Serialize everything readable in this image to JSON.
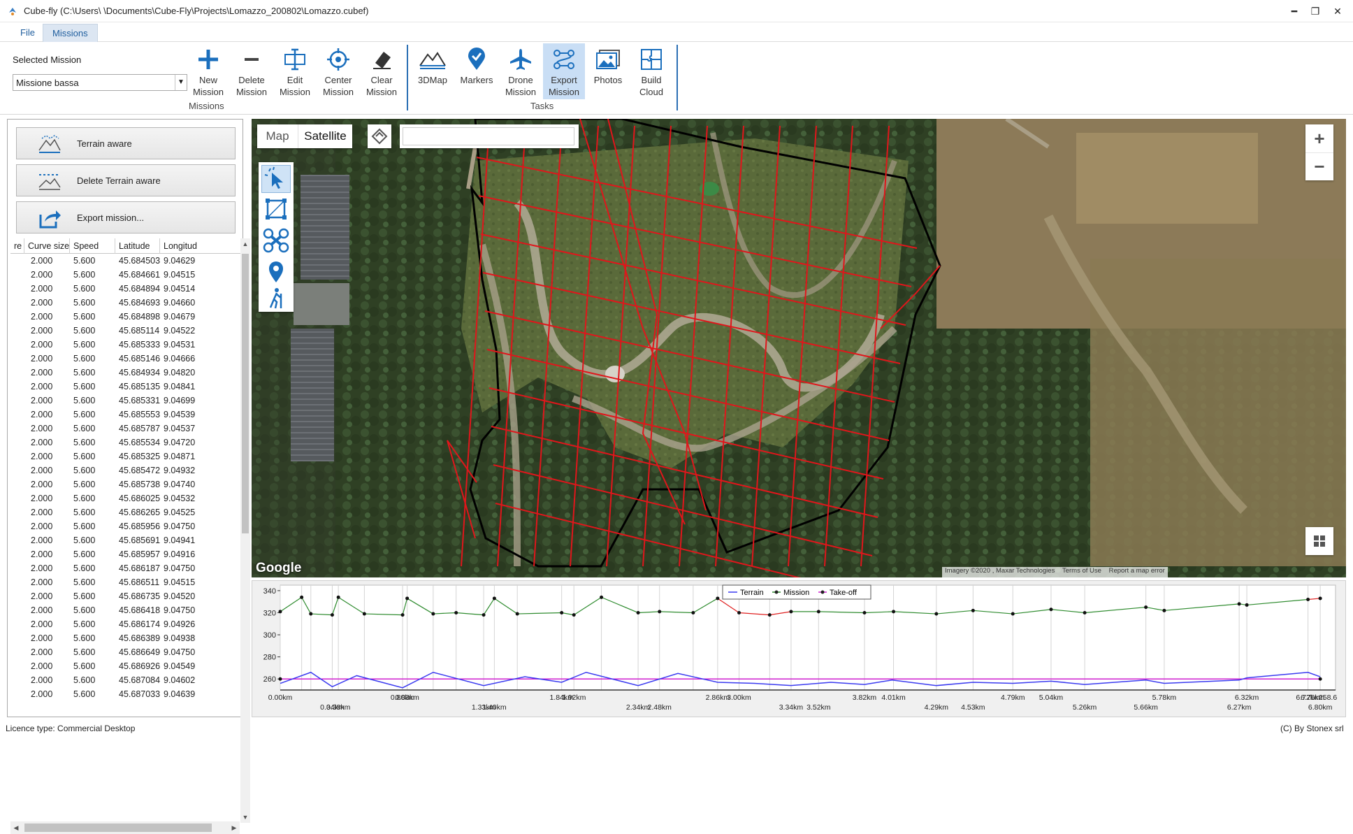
{
  "window": {
    "title": "Cube-fly (C:\\Users\\         \\Documents\\Cube-Fly\\Projects\\Lomazzo_200802\\Lomazzo.cubef)",
    "minimize": "━",
    "restore": "❐",
    "close": "✕"
  },
  "menu": {
    "tabs": [
      {
        "label": "File"
      },
      {
        "label": "Missions"
      }
    ]
  },
  "ribbon": {
    "selected_mission_label": "Selected Mission",
    "selected_mission_value": "Missione bassa",
    "groups": {
      "missions": "Missions",
      "tasks": "Tasks"
    },
    "buttons": {
      "new_mission": [
        "New",
        "Mission"
      ],
      "delete_mission": [
        "Delete",
        "Mission"
      ],
      "edit_mission": [
        "Edit",
        "Mission"
      ],
      "center_mission": [
        "Center",
        "Mission"
      ],
      "clear_mission": [
        "Clear",
        "Mission"
      ],
      "map3d": [
        "3DMap",
        ""
      ],
      "markers": [
        "Markers",
        ""
      ],
      "drone_mission": [
        "Drone",
        "Mission"
      ],
      "export_mission": [
        "Export",
        "Mission"
      ],
      "photos": [
        "Photos",
        ""
      ],
      "build_cloud": [
        "Build",
        "Cloud"
      ]
    },
    "accent": "#1b6fbd"
  },
  "left_panel": {
    "terrain_aware": "Terrain aware",
    "delete_terrain_aware": "Delete Terrain aware",
    "export_mission": "Export mission...",
    "table": {
      "columns": [
        "re",
        "Curve size",
        "Speed",
        "Latitude",
        "Longitud"
      ],
      "rows": [
        [
          "",
          "2.000",
          "5.600",
          "45.684503",
          "9.04629"
        ],
        [
          "",
          "2.000",
          "5.600",
          "45.684661",
          "9.04515"
        ],
        [
          "",
          "2.000",
          "5.600",
          "45.684894",
          "9.04514"
        ],
        [
          "",
          "2.000",
          "5.600",
          "45.684693",
          "9.04660"
        ],
        [
          "",
          "2.000",
          "5.600",
          "45.684898",
          "9.04679"
        ],
        [
          "",
          "2.000",
          "5.600",
          "45.685114",
          "9.04522"
        ],
        [
          "",
          "2.000",
          "5.600",
          "45.685333",
          "9.04531"
        ],
        [
          "",
          "2.000",
          "5.600",
          "45.685146",
          "9.04666"
        ],
        [
          "",
          "2.000",
          "5.600",
          "45.684934",
          "9.04820"
        ],
        [
          "",
          "2.000",
          "5.600",
          "45.685135",
          "9.04841"
        ],
        [
          "",
          "2.000",
          "5.600",
          "45.685331",
          "9.04699"
        ],
        [
          "",
          "2.000",
          "5.600",
          "45.685553",
          "9.04539"
        ],
        [
          "",
          "2.000",
          "5.600",
          "45.685787",
          "9.04537"
        ],
        [
          "",
          "2.000",
          "5.600",
          "45.685534",
          "9.04720"
        ],
        [
          "",
          "2.000",
          "5.600",
          "45.685325",
          "9.04871"
        ],
        [
          "",
          "2.000",
          "5.600",
          "45.685472",
          "9.04932"
        ],
        [
          "",
          "2.000",
          "5.600",
          "45.685738",
          "9.04740"
        ],
        [
          "",
          "2.000",
          "5.600",
          "45.686025",
          "9.04532"
        ],
        [
          "",
          "2.000",
          "5.600",
          "45.686265",
          "9.04525"
        ],
        [
          "",
          "2.000",
          "5.600",
          "45.685956",
          "9.04750"
        ],
        [
          "",
          "2.000",
          "5.600",
          "45.685691",
          "9.04941"
        ],
        [
          "",
          "2.000",
          "5.600",
          "45.685957",
          "9.04916"
        ],
        [
          "",
          "2.000",
          "5.600",
          "45.686187",
          "9.04750"
        ],
        [
          "",
          "2.000",
          "5.600",
          "45.686511",
          "9.04515"
        ],
        [
          "",
          "2.000",
          "5.600",
          "45.686735",
          "9.04520"
        ],
        [
          "",
          "2.000",
          "5.600",
          "45.686418",
          "9.04750"
        ],
        [
          "",
          "2.000",
          "5.600",
          "45.686174",
          "9.04926"
        ],
        [
          "",
          "2.000",
          "5.600",
          "45.686389",
          "9.04938"
        ],
        [
          "",
          "2.000",
          "5.600",
          "45.686649",
          "9.04750"
        ],
        [
          "",
          "2.000",
          "5.600",
          "45.686926",
          "9.04549"
        ],
        [
          "",
          "2.000",
          "5.600",
          "45.687084",
          "9.04602"
        ],
        [
          "",
          "2.000",
          "5.600",
          "45.687033",
          "9.04639"
        ]
      ]
    }
  },
  "map": {
    "tab_map": "Map",
    "tab_satellite": "Satellite",
    "search_value": "",
    "zoom_in": "+",
    "zoom_out": "−",
    "google": "Google",
    "attribution": "Imagery ©2020 , Maxar Technologies",
    "terms": "Terms of Use",
    "report": "Report a map error",
    "flight_color": "#e0161b",
    "boundary_color": "#000000"
  },
  "profile": {
    "legend": [
      "Terrain",
      "Mission",
      "Take-off"
    ],
    "y_ticks": [
      "340",
      "320",
      "300",
      "280",
      "260"
    ],
    "x_labels_top": [
      "0.00km",
      "0.80km",
      "0.83km",
      "1.84km",
      "1.92km",
      "2.86km",
      "3.00km",
      "3.82km",
      "4.01km",
      "4.79km",
      "5.04km",
      "5.78km",
      "6.32km",
      "6.72km",
      "6.75km",
      "258.6"
    ],
    "x_labels_bottom": [
      "0.34km",
      "0.38km",
      "1.33km",
      "1.40km",
      "2.34km",
      "2.48km",
      "3.34km",
      "3.52km",
      "4.29km",
      "4.53km",
      "5.26km",
      "5.66km",
      "6.27km",
      "6.80km"
    ],
    "colors": {
      "terrain": "#3a3af0",
      "mission": "#2e8b2e",
      "mission_alt": "#e02020",
      "takeoff": "#d020d0"
    }
  },
  "chart_data": {
    "type": "line",
    "legend": [
      "Terrain",
      "Mission",
      "Take-off"
    ],
    "ylim": [
      250,
      345
    ],
    "xlim": [
      0,
      6.9
    ],
    "series": [
      {
        "name": "Mission",
        "x": [
          0.0,
          0.14,
          0.2,
          0.34,
          0.38,
          0.55,
          0.8,
          0.83,
          1.0,
          1.15,
          1.33,
          1.4,
          1.55,
          1.84,
          1.92,
          2.1,
          2.34,
          2.48,
          2.7,
          2.86,
          3.0,
          3.2,
          3.34,
          3.52,
          3.82,
          4.01,
          4.29,
          4.53,
          4.79,
          5.04,
          5.26,
          5.66,
          5.78,
          6.27,
          6.32,
          6.72,
          6.8
        ],
        "y": [
          321,
          334,
          319,
          318,
          334,
          319,
          318,
          333,
          319,
          320,
          318,
          333,
          319,
          320,
          318,
          334,
          320,
          321,
          320,
          333,
          320,
          318,
          321,
          321,
          320,
          321,
          319,
          322,
          319,
          323,
          320,
          325,
          322,
          328,
          327,
          332,
          333
        ]
      },
      {
        "name": "Terrain",
        "x": [
          0.0,
          0.2,
          0.34,
          0.5,
          0.8,
          1.0,
          1.33,
          1.6,
          1.84,
          2.0,
          2.34,
          2.6,
          2.86,
          3.1,
          3.34,
          3.6,
          3.82,
          4.0,
          4.29,
          4.53,
          4.79,
          5.04,
          5.26,
          5.66,
          5.78,
          6.27,
          6.32,
          6.72,
          6.8
        ],
        "y": [
          256,
          266,
          253,
          263,
          252,
          266,
          254,
          262,
          257,
          266,
          254,
          265,
          257,
          256,
          254,
          257,
          255,
          259,
          254,
          257,
          256,
          258,
          255,
          259,
          256,
          259,
          261,
          266,
          262
        ]
      },
      {
        "name": "Take-off",
        "x": [
          0.0,
          6.8
        ],
        "y": [
          260,
          260
        ]
      }
    ]
  },
  "status": {
    "licence": "Licence type: Commercial Desktop",
    "copyright": "(C) By Stonex srl"
  }
}
